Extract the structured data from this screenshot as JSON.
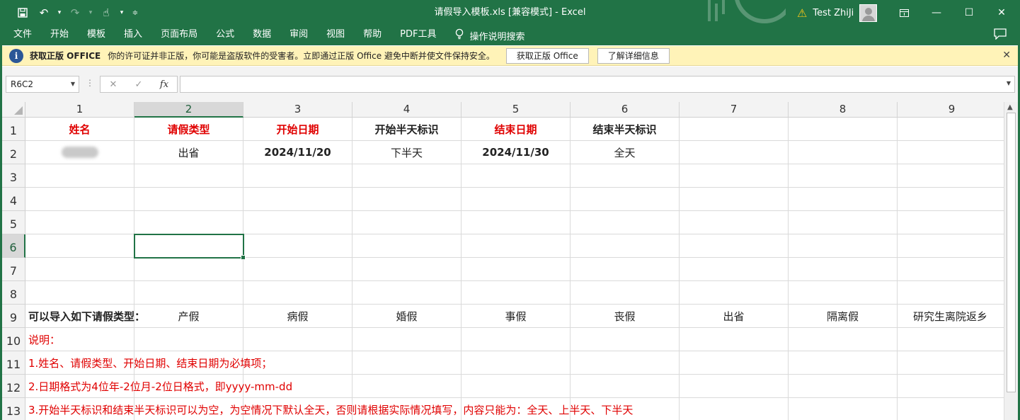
{
  "window": {
    "title": "请假导入模板.xls  [兼容模式]  -  Excel",
    "user_name": "Test ZhiJi",
    "accent": "#217346"
  },
  "ribbon_tabs": [
    "文件",
    "开始",
    "模板",
    "插入",
    "页面布局",
    "公式",
    "数据",
    "审阅",
    "视图",
    "帮助",
    "PDF工具"
  ],
  "tell_me": "操作说明搜索",
  "infobar": {
    "title": "获取正版 OFFICE",
    "message": "你的许可证并非正版，你可能是盗版软件的受害者。立即通过正版 Office 避免中断并使文件保持安全。",
    "button_get": "获取正版 Office",
    "button_learn": "了解详细信息"
  },
  "formula_bar": {
    "name_box": "R6C2",
    "formula": ""
  },
  "sheet": {
    "col_headers": [
      "1",
      "2",
      "3",
      "4",
      "5",
      "6",
      "7",
      "8",
      "9"
    ],
    "row_headers": [
      "1",
      "2",
      "3",
      "4",
      "5",
      "6",
      "7",
      "8",
      "9",
      "10",
      "11",
      "12",
      "13"
    ],
    "selected_cell": "R6C2",
    "header_row": [
      "姓名",
      "请假类型",
      "开始日期",
      "开始半天标识",
      "结束日期",
      "结束半天标识"
    ],
    "data_row": [
      "",
      "出省",
      "2024/11/20",
      "下半天",
      "2024/11/30",
      "全天"
    ],
    "types_label": "可以导入如下请假类型：",
    "leave_types": [
      "产假",
      "病假",
      "婚假",
      "事假",
      "丧假",
      "出省",
      "隔离假",
      "研究生离院返乡"
    ],
    "notes": [
      "说明：",
      "1.姓名、请假类型、开始日期、结束日期为必填项；",
      "2.日期格式为4位年-2位月-2位日格式，即yyyy-mm-dd",
      "3.开始半天标识和结束半天标识可以为空，为空情况下默认全天，否则请根据实际情况填写，内容只能为：全天、上半天、下半天"
    ],
    "required_color": "#e00000"
  }
}
